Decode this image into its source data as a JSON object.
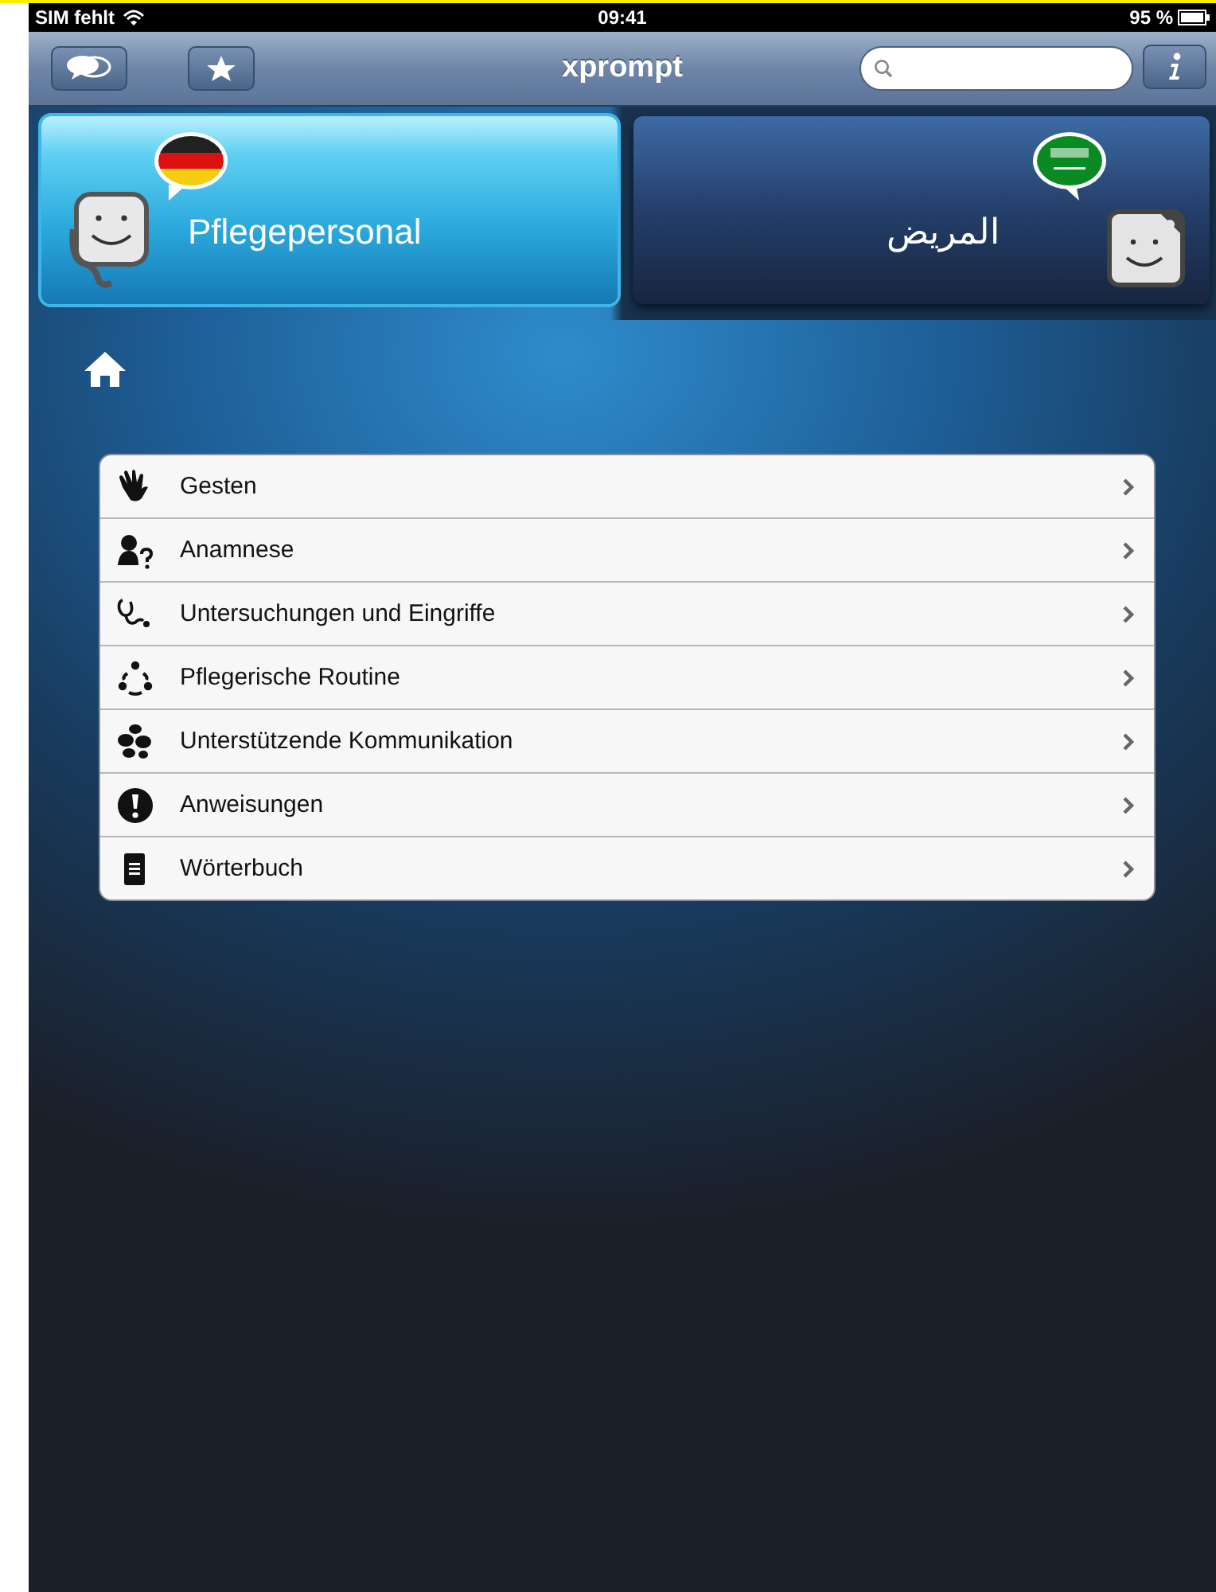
{
  "status_bar": {
    "carrier": "SIM fehlt",
    "time": "09:41",
    "battery": "95 %"
  },
  "nav_bar": {
    "title": "xprompt"
  },
  "speakers": [
    {
      "kind": "nurse",
      "label": "Pflegepersonal",
      "selected": true
    },
    {
      "kind": "patient",
      "label": "المريض",
      "selected": false
    }
  ],
  "menu": [
    {
      "label": "Gesten"
    },
    {
      "label": "Anamnese"
    },
    {
      "label": "Untersuchungen und Eingriffe"
    },
    {
      "label": "Pflegerische Routine"
    },
    {
      "label": "Unterstützende Kommunikation"
    },
    {
      "label": "Anweisungen"
    },
    {
      "label": "Wörterbuch"
    }
  ]
}
